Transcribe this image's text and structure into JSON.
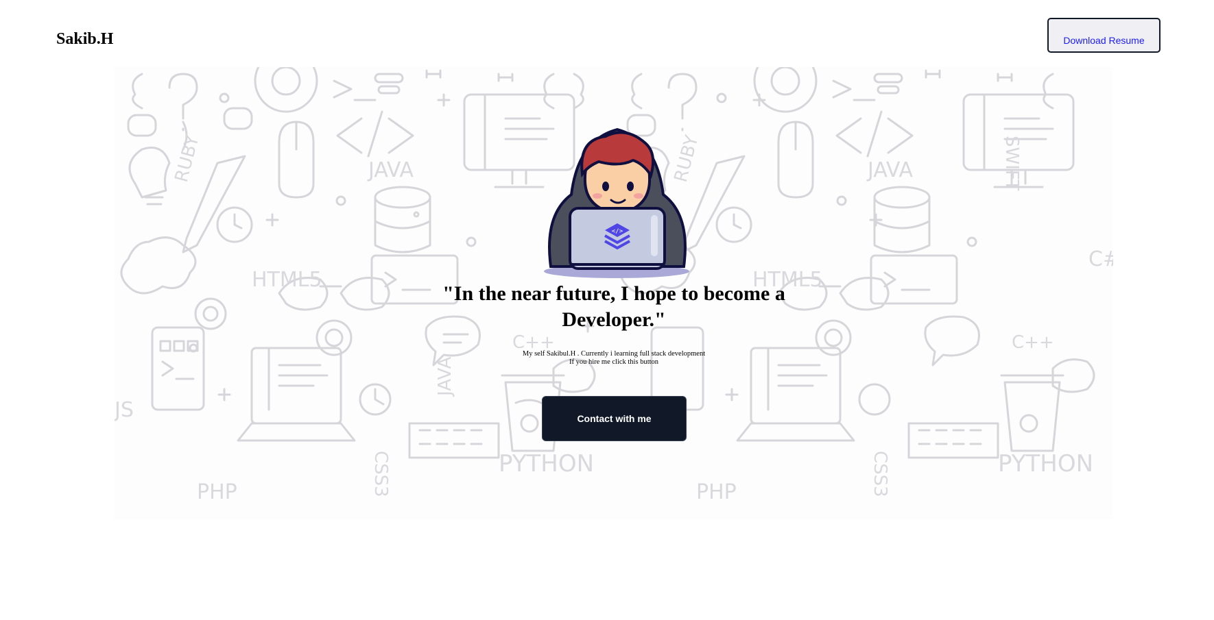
{
  "header": {
    "brand": "Sakib.H",
    "resume_label": "Download Resume"
  },
  "hero": {
    "background_icons": [
      "code-brackets-icon",
      "question-mark-icon",
      "gear-icon",
      "terminal-prompt-icon",
      "monitor-icon",
      "java-label",
      "ruby-label",
      "swift-label",
      "html5-label",
      "python-label",
      "php-label",
      "css3-label",
      "js-label",
      "c-plus-plus-label",
      "c-sharp-label",
      "database-icon",
      "lightbulb-icon",
      "pencil-icon",
      "clock-icon",
      "brain-icon",
      "glasses-icon",
      "laptop-icon",
      "phone-icon",
      "keyboard-icon",
      "coffee-cup-icon",
      "chat-bubble-icon",
      "mouse-icon"
    ],
    "doodle_words": [
      "JAVA",
      "RUBY",
      "HTML5",
      "SWIFT",
      "C#",
      "C++",
      "JAVA",
      "PYTHON",
      "PHP",
      "CSS3",
      "JS",
      "HTML5",
      "JAVA",
      "RUBY",
      "C++",
      "CSS3",
      "PYTHON",
      "PHP"
    ],
    "quote": "\"In the near future, I hope to become a Developer.\"",
    "bio_line1": "My self Sakibul.H . Currently i learning full stack development",
    "bio_line2": "If you hire me click this button",
    "contact_label": "Contact with me"
  },
  "colors": {
    "button_dark": "#111827",
    "link_blue": "#1a1aff",
    "doodle_gray": "#d4d4d8",
    "hoodie": "#4b4f5c",
    "hair": "#b83a3a",
    "laptop": "#c4cbe0",
    "logo_purple": "#4f46e5"
  }
}
